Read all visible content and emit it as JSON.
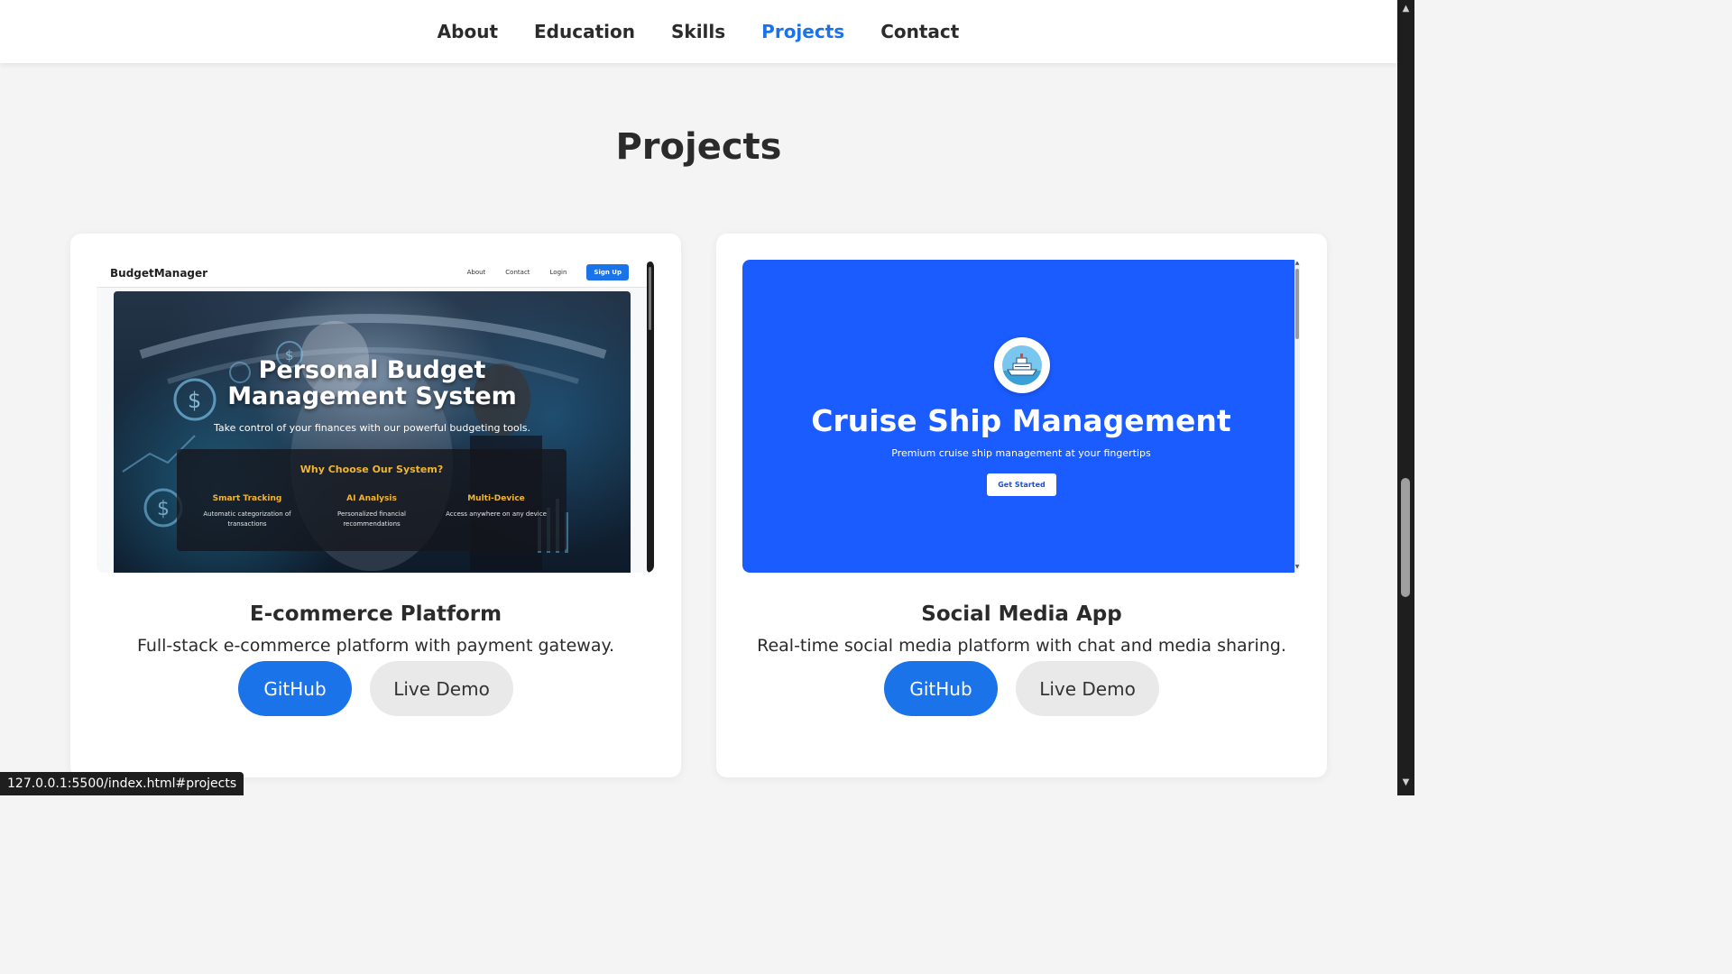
{
  "nav": {
    "links": [
      "About",
      "Education",
      "Skills",
      "Projects",
      "Contact"
    ],
    "active": "Projects"
  },
  "section": {
    "title": "Projects"
  },
  "projects": [
    {
      "title": "E-commerce Platform",
      "description": "Full-stack e-commerce platform with payment gateway.",
      "github_label": "GitHub",
      "demo_label": "Live Demo",
      "preview": {
        "logo": "BudgetManager",
        "nav_links": [
          "About",
          "Contact",
          "Login"
        ],
        "signup": "Sign Up",
        "hero_title_line1": "Personal Budget",
        "hero_title_line2": "Management System",
        "hero_subtitle": "Take control of your finances with our powerful budgeting tools.",
        "why_title": "Why Choose Our System?",
        "features": [
          {
            "name": "Smart Tracking",
            "desc": "Automatic categorization of transactions"
          },
          {
            "name": "AI Analysis",
            "desc": "Personalized financial recommendations"
          },
          {
            "name": "Multi-Device",
            "desc": "Access anywhere on any device"
          }
        ]
      }
    },
    {
      "title": "Social Media App",
      "description": "Real-time social media platform with chat and media sharing.",
      "github_label": "GitHub",
      "demo_label": "Live Demo",
      "preview": {
        "title": "Cruise Ship Management",
        "subtitle": "Premium cruise ship management at your fingertips",
        "button": "Get Started",
        "logo_icon": "ship-icon"
      }
    }
  ],
  "status_bar": {
    "url": "127.0.0.1:5500/index.html#projects"
  },
  "colors": {
    "accent": "#1a73e8",
    "cruise_blue": "#1a5cff",
    "background": "#f4f4f4",
    "gold": "#f2b632"
  }
}
